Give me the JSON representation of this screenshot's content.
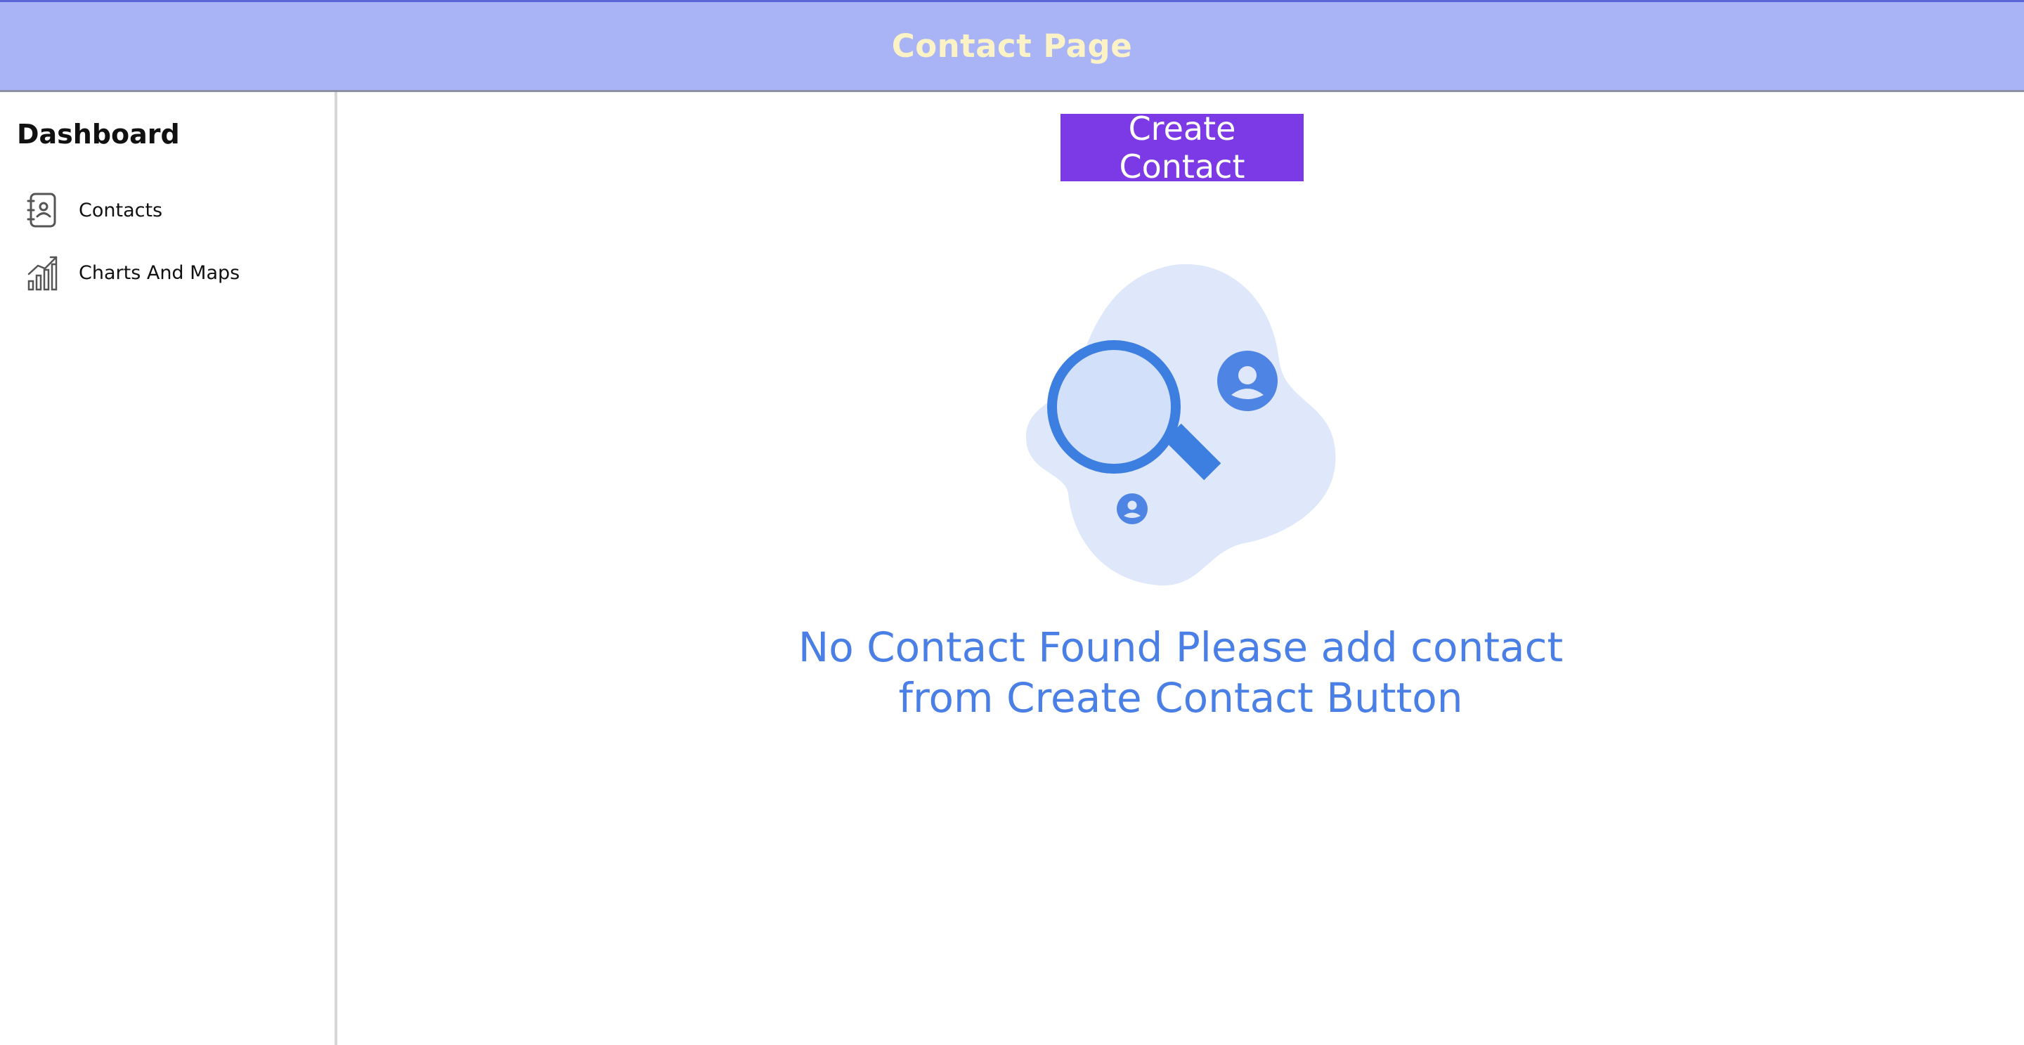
{
  "header": {
    "title": "Contact Page",
    "background": "#a9b4f6",
    "title_color": "#fbf3c6"
  },
  "sidebar": {
    "title": "Dashboard",
    "items": [
      {
        "label": "Contacts",
        "icon": "address-book-icon"
      },
      {
        "label": "Charts And Maps",
        "icon": "bar-chart-trend-icon"
      }
    ]
  },
  "main": {
    "create_button": {
      "label": "Create Contact",
      "color": "#7b3ae6"
    },
    "empty_state": {
      "icon": "contact-search-illustration",
      "message": "No Contact Found Please add contact from Create Contact Button",
      "message_color": "#4a7fe6"
    }
  }
}
